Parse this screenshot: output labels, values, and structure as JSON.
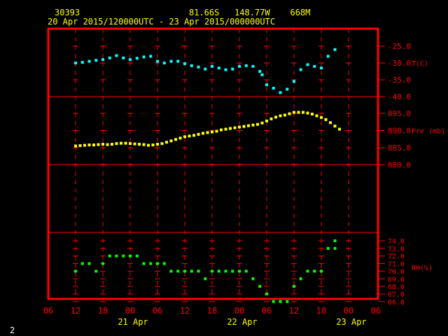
{
  "header": {
    "station": "30393",
    "location": "81.66S   148.77W    668M",
    "period": "20 Apr 2015/120000UTC - 23 Apr 2015/000000UTC"
  },
  "footer": {
    "page": "2"
  },
  "colors": {
    "frame": "#ff0000",
    "grid": "#ff0000",
    "labels": "#ff0000",
    "time_labels": "#ffff00",
    "temperature": "#00ffff",
    "pressure": "#ffff00",
    "rh": "#00ff00"
  },
  "chart_data": {
    "type": "scatter",
    "x_tick_labels": [
      "06",
      "12",
      "18",
      "00",
      "06",
      "12",
      "18",
      "00",
      "06",
      "12",
      "18",
      "00",
      "06"
    ],
    "x_tick_hours": [
      -6,
      0,
      6,
      12,
      18,
      24,
      30,
      36,
      42,
      48,
      54,
      60,
      66
    ],
    "date_labels": [
      {
        "label": "21 Apr",
        "hour": 12
      },
      {
        "label": "22 Apr",
        "hour": 36
      },
      {
        "label": "23 Apr",
        "hour": 60
      }
    ],
    "x_unit_note": "hours since 20 Apr 2015 12 UTC",
    "panels": [
      {
        "name": "temperature",
        "label": "T(C)",
        "ylim": [
          -40,
          -25
        ],
        "ticks": [
          -25.0,
          -30.0,
          -35.0,
          -40.0
        ],
        "tick_labels": [
          "-25.0",
          "-30.0",
          "-35.0",
          "-40.0"
        ],
        "label_at": -30,
        "points": [
          [
            0,
            -30.0
          ],
          [
            1.5,
            -29.8
          ],
          [
            3,
            -29.5
          ],
          [
            4.5,
            -29.2
          ],
          [
            6,
            -29.0
          ],
          [
            7.5,
            -28.5
          ],
          [
            9,
            -27.8
          ],
          [
            10.5,
            -28.5
          ],
          [
            12,
            -29.0
          ],
          [
            13.5,
            -28.6
          ],
          [
            15,
            -28.2
          ],
          [
            16.5,
            -28.0
          ],
          [
            18,
            -29.5
          ],
          [
            19.5,
            -30.0
          ],
          [
            21,
            -29.5
          ],
          [
            22.5,
            -29.5
          ],
          [
            24,
            -30.2
          ],
          [
            25.5,
            -30.8
          ],
          [
            27,
            -31.2
          ],
          [
            28.5,
            -31.8
          ],
          [
            30,
            -31.0
          ],
          [
            31.5,
            -31.5
          ],
          [
            33,
            -32.0
          ],
          [
            34.5,
            -31.8
          ],
          [
            36,
            -31.0
          ],
          [
            37.5,
            -30.8
          ],
          [
            39,
            -31.0
          ],
          [
            40.5,
            -32.5
          ],
          [
            41,
            -33.5
          ],
          [
            42,
            -36.5
          ],
          [
            43.5,
            -37.5
          ],
          [
            45,
            -38.8
          ],
          [
            46.5,
            -37.8
          ],
          [
            48,
            -35.5
          ],
          [
            49.5,
            -32.0
          ],
          [
            51,
            -30.5
          ],
          [
            52.5,
            -31.0
          ],
          [
            54,
            -31.5
          ],
          [
            55.5,
            -28.0
          ],
          [
            57,
            -26.0
          ]
        ]
      },
      {
        "name": "pressure",
        "label": "Pre (mb)",
        "ylim": [
          880,
          897.5
        ],
        "ticks": [
          895.0,
          890.0,
          885.0,
          880.0
        ],
        "tick_labels": [
          "895.0",
          "890.0",
          "885.0",
          "880.0"
        ],
        "label_at": 890,
        "points": [
          [
            0,
            885.5
          ],
          [
            1,
            885.6
          ],
          [
            2,
            885.7
          ],
          [
            3,
            885.8
          ],
          [
            4,
            885.8
          ],
          [
            5,
            885.9
          ],
          [
            6,
            886.0
          ],
          [
            7,
            885.9
          ],
          [
            8,
            886.0
          ],
          [
            9,
            886.2
          ],
          [
            10,
            886.3
          ],
          [
            11,
            886.3
          ],
          [
            12,
            886.2
          ],
          [
            13,
            886.1
          ],
          [
            14,
            886.0
          ],
          [
            15,
            885.9
          ],
          [
            16,
            885.7
          ],
          [
            17,
            885.8
          ],
          [
            18,
            886.0
          ],
          [
            19,
            886.2
          ],
          [
            20,
            886.6
          ],
          [
            21,
            887.0
          ],
          [
            22,
            887.4
          ],
          [
            23,
            887.8
          ],
          [
            24,
            888.2
          ],
          [
            25,
            888.4
          ],
          [
            26,
            888.6
          ],
          [
            27,
            888.9
          ],
          [
            28,
            889.2
          ],
          [
            29,
            889.4
          ],
          [
            30,
            889.6
          ],
          [
            31,
            889.8
          ],
          [
            32,
            890.2
          ],
          [
            33,
            890.4
          ],
          [
            34,
            890.6
          ],
          [
            35,
            890.8
          ],
          [
            36,
            891.0
          ],
          [
            37,
            891.2
          ],
          [
            38,
            891.4
          ],
          [
            39,
            891.6
          ],
          [
            40,
            891.8
          ],
          [
            41,
            892.2
          ],
          [
            42,
            892.8
          ],
          [
            43,
            893.4
          ],
          [
            44,
            893.9
          ],
          [
            45,
            894.3
          ],
          [
            46,
            894.5
          ],
          [
            47,
            894.9
          ],
          [
            48,
            895.3
          ],
          [
            49,
            895.3
          ],
          [
            50,
            895.3
          ],
          [
            51,
            895.1
          ],
          [
            52,
            894.8
          ],
          [
            53,
            894.3
          ],
          [
            54,
            893.8
          ],
          [
            55,
            893.2
          ],
          [
            56,
            892.3
          ],
          [
            57,
            891.3
          ],
          [
            58,
            890.4
          ]
        ]
      },
      {
        "name": "rh",
        "label": "RH(%)",
        "ylim": [
          66,
          74.5
        ],
        "ticks": [
          74.0,
          73.0,
          72.0,
          71.0,
          70.0,
          69.0,
          68.0,
          67.0,
          66.0
        ],
        "tick_labels": [
          "74.0",
          "73.0",
          "72.0",
          "71.0",
          "70.0",
          "69.0",
          "68.0",
          "67.0",
          "66.0"
        ],
        "label_at": 70.5,
        "points": [
          [
            0,
            70
          ],
          [
            1.5,
            71
          ],
          [
            3,
            71
          ],
          [
            4.5,
            70
          ],
          [
            6,
            71
          ],
          [
            7.5,
            72
          ],
          [
            9,
            72
          ],
          [
            10.5,
            72
          ],
          [
            12,
            72
          ],
          [
            13.5,
            72
          ],
          [
            15,
            71
          ],
          [
            16.5,
            71
          ],
          [
            18,
            71
          ],
          [
            19.5,
            71
          ],
          [
            21,
            70
          ],
          [
            22.5,
            70
          ],
          [
            24,
            70
          ],
          [
            25.5,
            70
          ],
          [
            27,
            70
          ],
          [
            28.5,
            69
          ],
          [
            30,
            70
          ],
          [
            31.5,
            70
          ],
          [
            33,
            70
          ],
          [
            34.5,
            70
          ],
          [
            36,
            70
          ],
          [
            37.5,
            70
          ],
          [
            39,
            69
          ],
          [
            40.5,
            68
          ],
          [
            42,
            67
          ],
          [
            43.5,
            66
          ],
          [
            45,
            66
          ],
          [
            46.5,
            66
          ],
          [
            48,
            68
          ],
          [
            49.5,
            69
          ],
          [
            51,
            70
          ],
          [
            52.5,
            70
          ],
          [
            54,
            70
          ],
          [
            55.5,
            73
          ],
          [
            57,
            73
          ],
          [
            57,
            74
          ]
        ]
      }
    ]
  }
}
